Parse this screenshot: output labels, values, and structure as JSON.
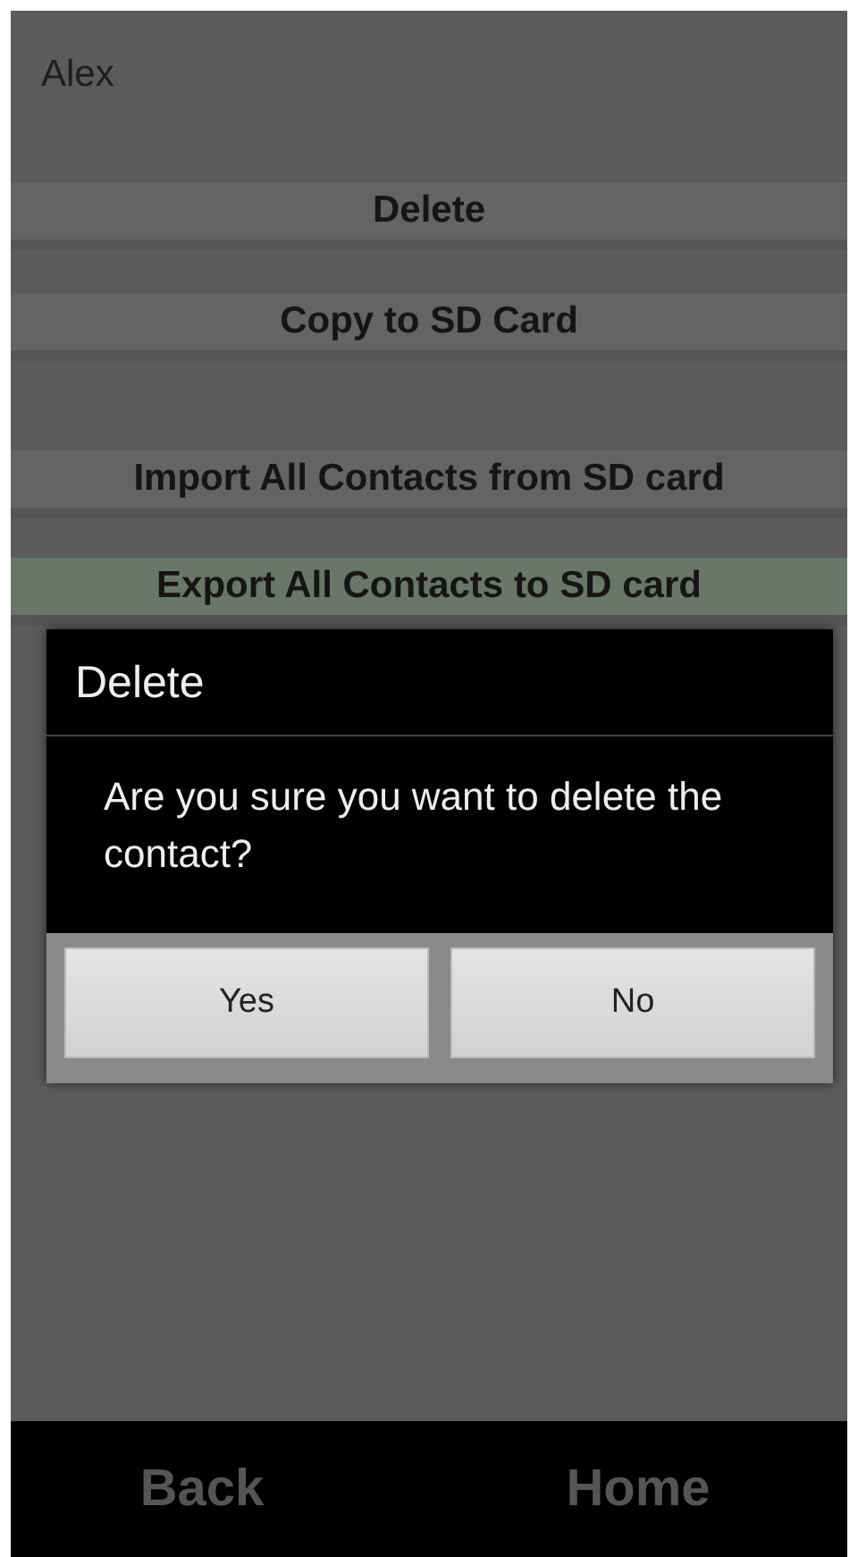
{
  "contact": {
    "name": "Alex"
  },
  "menu": [
    {
      "label": "Delete",
      "selected": false
    },
    {
      "label": "Copy to SD Card",
      "selected": false
    },
    {
      "label": "Import All Contacts from SD card",
      "selected": false
    },
    {
      "label": "Export All Contacts to SD card",
      "selected": true
    }
  ],
  "dialog": {
    "title": "Delete",
    "message": "Are you sure you want to delete the contact?",
    "buttons": [
      "Yes",
      "No"
    ]
  },
  "nav": [
    "Back",
    "Home"
  ]
}
